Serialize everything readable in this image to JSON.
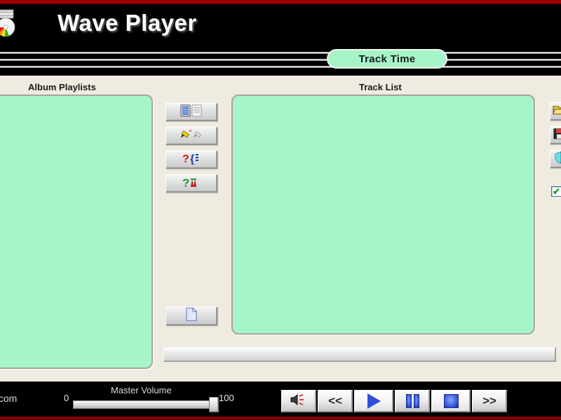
{
  "window": {
    "app_title": "Wave Player",
    "app_icon": "cd-disc-icon",
    "accent_red": "#b80000",
    "panel_bg": "#efebe0",
    "list_bg": "#a6f5c8",
    "header_bg": "#000000"
  },
  "display": {
    "track_time_label": "Track Time"
  },
  "panels": {
    "album_playlists": {
      "label": "Album Playlists",
      "items": []
    },
    "track_list": {
      "label": "Track List",
      "items": []
    }
  },
  "mid_toolbar": {
    "buttons": [
      {
        "name": "copy-playlist-button",
        "icon": "two-notepads-icon",
        "tooltip": "Copy Playlist"
      },
      {
        "name": "edit-playlist-button",
        "icon": "pencil-edit-icon",
        "tooltip": "Edit Playlist"
      },
      {
        "name": "query-playlist-button",
        "icon": "red-question-bracket-icon",
        "tooltip": "Find"
      },
      {
        "name": "help-playlist-button",
        "icon": "green-question-icon",
        "tooltip": "Help"
      }
    ],
    "new_document_button": {
      "name": "new-document-button",
      "icon": "blank-page-icon",
      "tooltip": "New"
    }
  },
  "right_toolbar": {
    "buttons": [
      {
        "name": "open-folder-button",
        "icon": "open-folder-icon",
        "tooltip": "Open"
      },
      {
        "name": "save-button",
        "icon": "floppy-disk-icon",
        "tooltip": "Save"
      },
      {
        "name": "shield-button",
        "icon": "shield-icon",
        "tooltip": "Protect"
      }
    ],
    "checkbox": {
      "name": "option-checkbox",
      "checked": true,
      "glyph": "✔"
    }
  },
  "status": {
    "progress_percent": 0,
    "text": ""
  },
  "footer": {
    "site_text": ".com",
    "volume": {
      "label": "Master Volume",
      "min": "0",
      "max": "100",
      "value": 100
    },
    "transport": {
      "mute_label": "",
      "rewind_label": "<<",
      "play_label": "",
      "pause_label": "",
      "stop_label": "",
      "forward_label": ">>"
    }
  }
}
